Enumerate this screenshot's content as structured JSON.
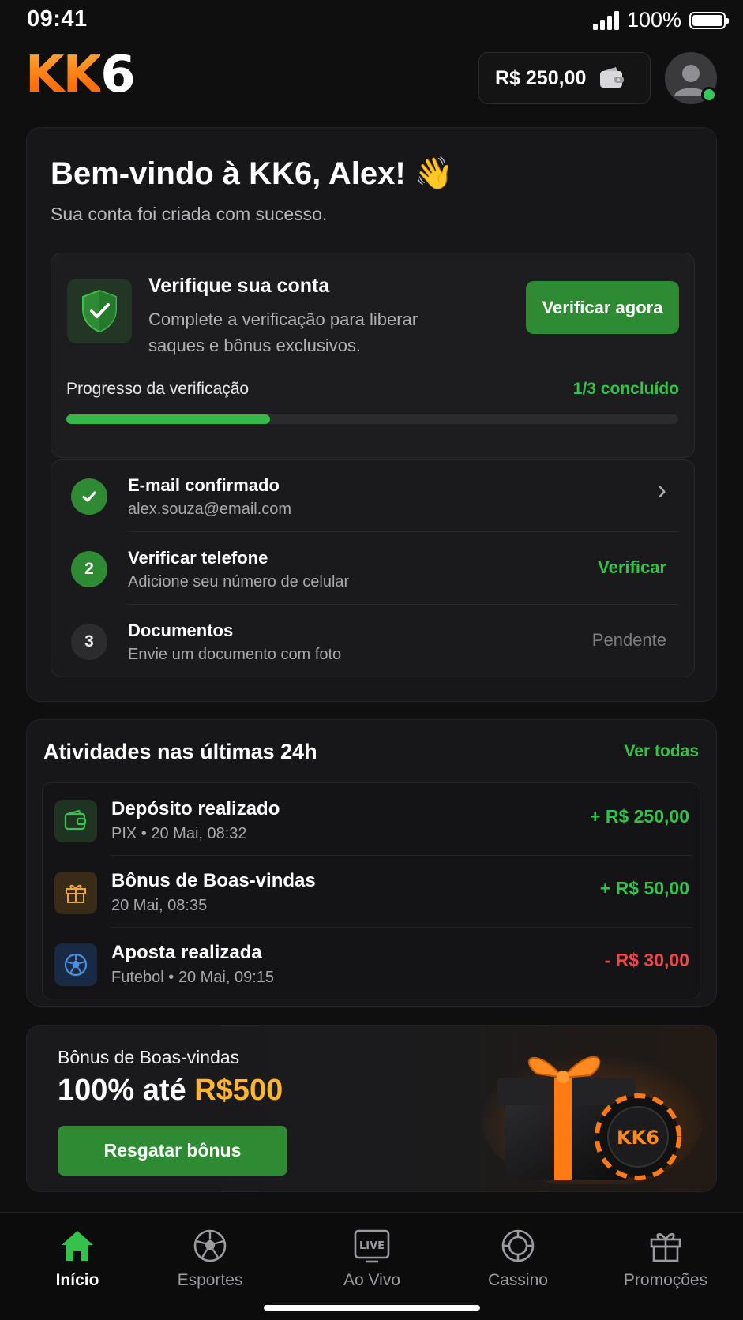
{
  "status_bar": {
    "time": "09:41",
    "battery": "100%"
  },
  "header": {
    "logo_kk": "KK",
    "logo_six": "6",
    "balance": "R$ 250,00"
  },
  "welcome": {
    "title": "Bem-vindo à KK6, Alex! 👋",
    "subtitle": "Sua conta foi criada com sucesso.",
    "verify": {
      "title": "Verifique sua conta",
      "description": "Complete a verificação para liberar saques e bônus exclusivos.",
      "button": "Verificar agora",
      "progress_label": "Progresso da verificação",
      "progress_status": "1/3 concluído",
      "progress_fraction": 0.3333
    },
    "steps": [
      {
        "marker": "✓",
        "title": "E-mail confirmado",
        "subtitle": "alex.souza@email.com",
        "action": "›",
        "state": "done"
      },
      {
        "marker": "2",
        "title": "Verificar telefone",
        "subtitle": "Adicione seu número de celular",
        "action": "Verificar",
        "state": "active"
      },
      {
        "marker": "3",
        "title": "Documentos",
        "subtitle": "Envie um documento com foto",
        "action": "Pendente",
        "state": "pending"
      }
    ]
  },
  "activity": {
    "title": "Atividades nas últimas 24h",
    "link": "Ver todas",
    "items": [
      {
        "icon": "wallet-icon",
        "name": "Depósito realizado",
        "meta": "PIX • 20 Mai, 08:32",
        "amount": "+ R$ 250,00",
        "color": "#35c24a"
      },
      {
        "icon": "gift-icon",
        "name": "Bônus de Boas-vindas",
        "meta": "20 Mai, 08:35",
        "amount": "+ R$ 50,00",
        "color": "#35c24a"
      },
      {
        "icon": "soccer-ball-icon",
        "name": "Aposta realizada",
        "meta": "Futebol • 20 Mai, 09:15",
        "amount": "- R$ 30,00",
        "color": "#f04848"
      }
    ]
  },
  "promo": {
    "kicker": "Bônus de Boas-vindas",
    "headline_prefix": "100% até ",
    "headline_highlight": "R$500",
    "button": "Resgatar bônus",
    "chip_text": "KK6"
  },
  "tabs": [
    {
      "label": "Início",
      "icon": "home-icon",
      "active": true
    },
    {
      "label": "Esportes",
      "icon": "soccer-ball-icon",
      "active": false
    },
    {
      "label": "Ao Vivo",
      "icon": "live-tv-icon",
      "active": false,
      "badge": "LIVE"
    },
    {
      "label": "Cassino",
      "icon": "casino-chip-icon",
      "active": false
    },
    {
      "label": "Promoções",
      "icon": "gift-icon",
      "active": false
    }
  ],
  "colors": {
    "accent_green": "#2e8b34",
    "positive": "#35c24a",
    "negative": "#f04848",
    "brand_orange": "#ff7a12",
    "highlight_gold": "#ffb62e"
  }
}
